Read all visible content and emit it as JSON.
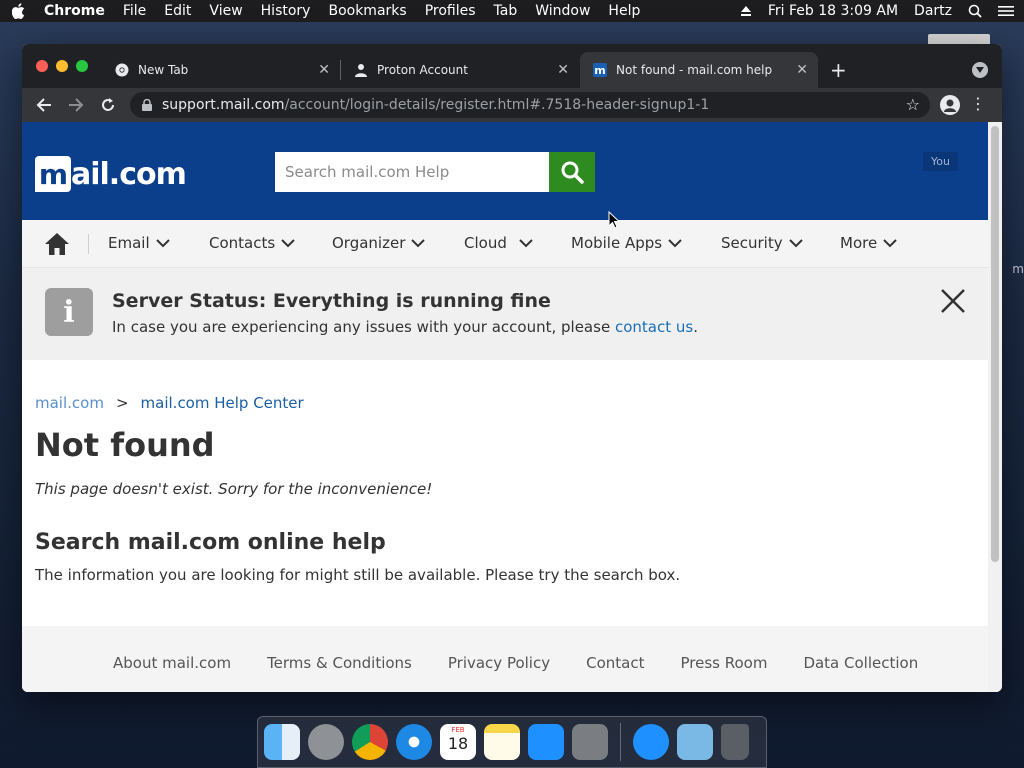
{
  "menubar": {
    "app": "Chrome",
    "items": [
      "File",
      "Edit",
      "View",
      "History",
      "Bookmarks",
      "Profiles",
      "Tab",
      "Window",
      "Help"
    ],
    "datetime": "Fri Feb 18  3:09 AM",
    "user": "Dartz"
  },
  "desktop": {
    "peek_text": "m"
  },
  "browser": {
    "tabs": [
      {
        "title": "New Tab",
        "icon": "chrome-icon",
        "active": false
      },
      {
        "title": "Proton Account",
        "icon": "person-icon",
        "active": false
      },
      {
        "title": "Not found - mail.com help",
        "icon": "mailcom-favicon",
        "active": true
      }
    ],
    "url_host": "support.mail.com",
    "url_path": "/account/login-details/register.html#.7518-header-signup1-1"
  },
  "site": {
    "logo_m": "m",
    "logo_rest": "ail.com",
    "search_placeholder": "Search mail.com Help",
    "you_badge": "You",
    "nav": [
      "Email",
      "Contacts",
      "Organizer",
      "Cloud",
      "Mobile Apps",
      "Security",
      "More"
    ],
    "status_title": "Server Status: Everything is running fine",
    "status_msg_prefix": "In case you are experiencing any issues with your account, please ",
    "status_link": "contact us",
    "status_msg_suffix": ".",
    "breadcrumb": {
      "home": "mail.com",
      "separator": ">",
      "current": "mail.com Help Center"
    },
    "heading": "Not found",
    "subheading": "This page doesn't exist. Sorry for the inconvenience!",
    "search_heading": "Search mail.com online help",
    "search_text": "The information you are looking for might still be available. Please try the search box.",
    "footer": [
      "About mail.com",
      "Terms & Conditions",
      "Privacy Policy",
      "Contact",
      "Press Room",
      "Data Collection"
    ]
  },
  "dock": {
    "calendar_month": "FEB",
    "calendar_day": "18",
    "apps": [
      "finder-icon",
      "launchpad-icon",
      "chrome-icon",
      "safari-icon",
      "calendar-icon",
      "notes-icon",
      "app-store-icon",
      "system-preferences-icon",
      "app-store-icon",
      "downloads-folder-icon",
      "trash-icon"
    ]
  },
  "colors": {
    "brand_blue": "#0b3f8c",
    "search_green": "#2e8b1f",
    "link_blue": "#1a6fb5"
  }
}
